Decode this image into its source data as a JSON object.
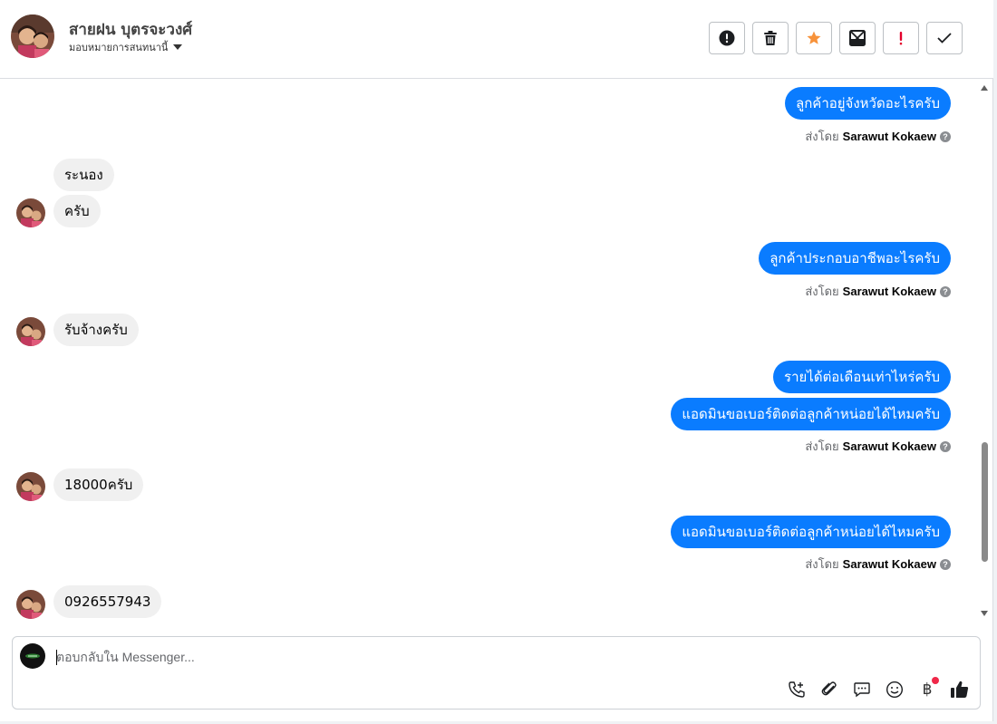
{
  "header": {
    "contact_name": "สายฝน บุตรจะวงศ์",
    "assign_label": "มอบหมายการสนทนานี้",
    "toolbar": [
      {
        "name": "spam-button",
        "icon": "alert-circle-icon"
      },
      {
        "name": "delete-button",
        "icon": "trash-icon"
      },
      {
        "name": "star-button",
        "icon": "star-icon",
        "color": "#f7923a"
      },
      {
        "name": "mark-unread-button",
        "icon": "envelope-x-icon"
      },
      {
        "name": "follow-up-button",
        "icon": "exclamation-icon",
        "color": "#e4002b"
      },
      {
        "name": "done-button",
        "icon": "check-icon"
      }
    ]
  },
  "thread": {
    "sent_by_prefix": "ส่งโดย",
    "agent_name": "Sarawut Kokaew",
    "messages": [
      {
        "dir": "out",
        "text": "ลูกค้าอยู่จังหวัดอะไรครับ"
      },
      {
        "dir": "in",
        "text": "ระนอง"
      },
      {
        "dir": "in",
        "text": "ครับ"
      },
      {
        "dir": "out",
        "text": "ลูกค้าประกอบอาชีพอะไรครับ"
      },
      {
        "dir": "in",
        "text": "รับจ้างครับ"
      },
      {
        "dir": "out",
        "text": "รายได้ต่อเดือนเท่าไหร่ครับ"
      },
      {
        "dir": "out",
        "text": "แอดมินขอเบอร์ติดต่อลูกค้าหน่อยได้ไหมครับ"
      },
      {
        "dir": "in",
        "text": "18000ครับ"
      },
      {
        "dir": "out",
        "text": "แอดมินขอเบอร์ติดต่อลูกค้าหน่อยได้ไหมครับ"
      },
      {
        "dir": "in",
        "text": "0926557943"
      }
    ]
  },
  "composer": {
    "placeholder": "ตอบกลับใน Messenger...",
    "tools": [
      "phone-plus-icon",
      "paperclip-icon",
      "saved-reply-icon",
      "emoji-icon",
      "baht-icon",
      "thumbs-up-icon"
    ],
    "baht_symbol": "฿"
  },
  "colors": {
    "outgoing_bubble": "#0a7cff",
    "incoming_bubble": "#f0f0f0"
  }
}
